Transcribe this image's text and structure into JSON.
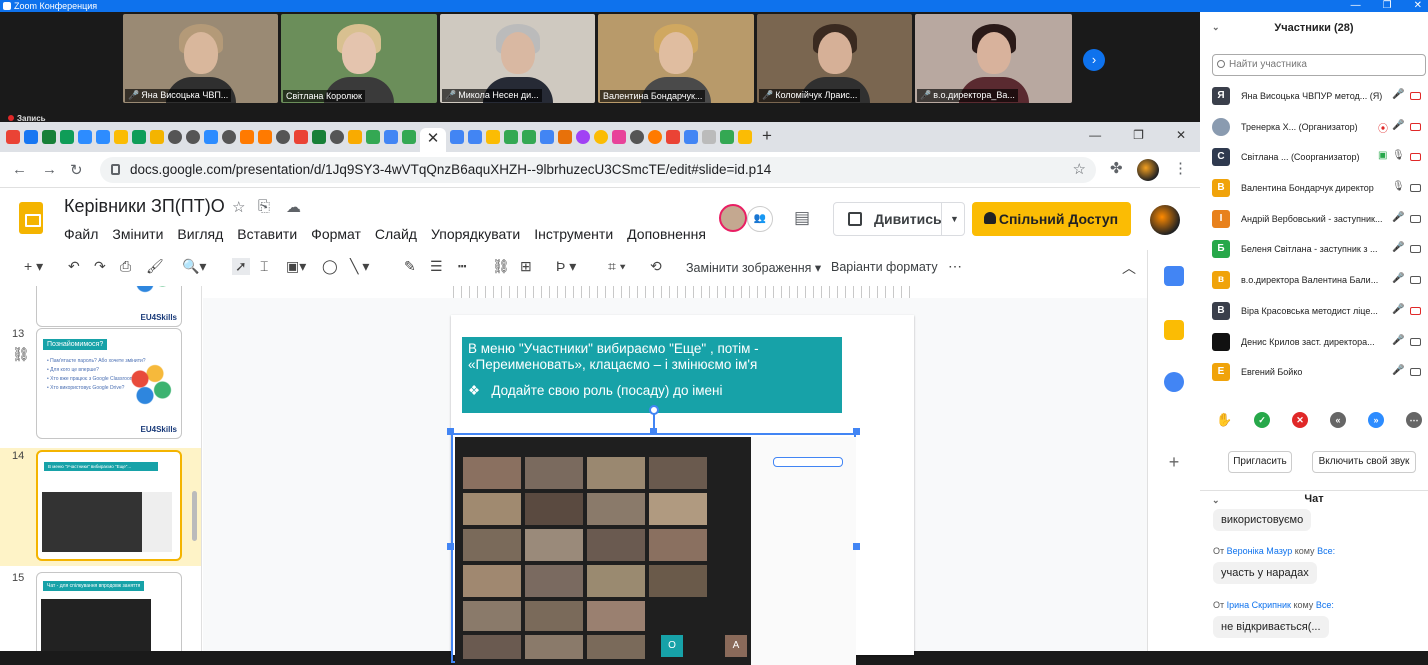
{
  "zoom": {
    "window_title": "Zoom Конференция",
    "recording_label": "Запись",
    "gallery": [
      {
        "name": "Яна Висоцька ЧВП..."
      },
      {
        "name": "Світлана Королюк"
      },
      {
        "name": "Микола Несен ди..."
      },
      {
        "name": "Валентина Бондарчук..."
      },
      {
        "name": "Коломійчук Лраис..."
      },
      {
        "name": "в.о.директора_Ва..."
      }
    ],
    "participants": {
      "header": "Участники (28)",
      "search_placeholder": "Найти участника",
      "list": [
        {
          "initial": "Я",
          "color": "#3a3f4b",
          "name": "Яна Висоцька ЧВПУР метод... (Я)"
        },
        {
          "initial": "",
          "color": "#8a9bb0",
          "name": "Тренерка Х... (Организатор)"
        },
        {
          "initial": "С",
          "color": "#2f3a4f",
          "name": "Світлана ... (Соорганизатор)"
        },
        {
          "initial": "В",
          "color": "#f0a30a",
          "name": "Валентина Бондарчук директор"
        },
        {
          "initial": "І",
          "color": "#e8811c",
          "name": "Андрій Вербовський - заступник..."
        },
        {
          "initial": "Б",
          "color": "#27a84a",
          "name": "Беленя Світлана - заступник з ..."
        },
        {
          "initial": "в",
          "color": "#f0a30a",
          "name": "в.о.директора  Валентина Бали..."
        },
        {
          "initial": "В",
          "color": "#3a3f4b",
          "name": "Віра Красовська методист ліце..."
        },
        {
          "initial": "",
          "color": "#111111",
          "name": "Денис Крилов заст. директора..."
        },
        {
          "initial": "Е",
          "color": "#f0a30a",
          "name": "Евгений Бойко"
        }
      ],
      "invite_label": "Пригласить",
      "unmute_label": "Включить свой звук"
    },
    "chat": {
      "header": "Чат",
      "messages": [
        {
          "from": "",
          "to": "",
          "text": "використовуємо"
        },
        {
          "from": "Вероніка Мазур",
          "to": "Все:",
          "text": "участь у нарадах"
        },
        {
          "from": "Ірина Скрипник",
          "to": "Все:",
          "text": "не відкривається(..."
        }
      ],
      "from_prefix": "От",
      "to_word": "кому"
    }
  },
  "browser": {
    "url": "docs.google.com/presentation/d/1Jq9SY3-4wVTqQnzB6aquXHZH--9lbrhuzecU3CSmcTE/edit#slide=id.p14"
  },
  "slides": {
    "doc_title": "Керівники ЗП(ПТ)О",
    "menus": [
      "Файл",
      "Змінити",
      "Вигляд",
      "Вставити",
      "Формат",
      "Слайд",
      "Упорядкувати",
      "Інструменти",
      "Доповнення"
    ],
    "present_label": "Дивитись",
    "share_label": "Спільний Доступ",
    "toolbar": {
      "replace_image": "Замінити зображення",
      "format_options": "Варіанти формату"
    },
    "thumbnails": [
      {
        "num": "13",
        "title": "Познайомимося?",
        "logo": "EU4Skills"
      },
      {
        "num": "14",
        "title": "В меню \"Участники\" вибираємо \"Еще\"..."
      },
      {
        "num": "15",
        "title": "Чат - для спілкування впродовж заняття"
      }
    ],
    "thumb13_lines": [
      "• Пам'ятаєте пароль? Або хочете змінити?",
      "• Для кого це вперше?",
      "• Хто вже працює з Google Classroom?",
      "• Хто використовує Google Drive?"
    ],
    "current_slide": {
      "line1": "В меню \"Участники\" вибираємо \"Еще\" , потім -",
      "line2": "«Переименовать», клацаємо – і змінюємо ім'я",
      "bullet": "Додайте свою роль (посаду) до імені",
      "bullet_mark": "❖",
      "tile_a": "О",
      "tile_b": "А"
    },
    "eu4skills": "EU4Skills"
  }
}
